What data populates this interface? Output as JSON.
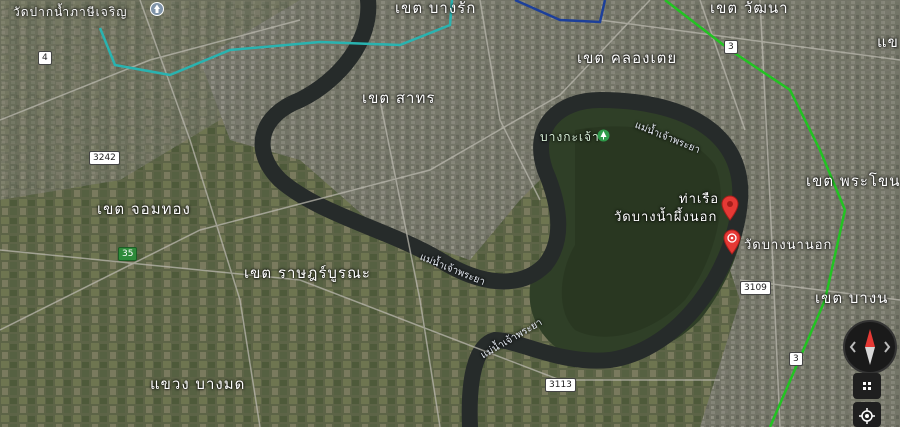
{
  "districts": {
    "bang_rak": "เขต บางรัก",
    "wattana": "เขต วัฒนา",
    "khlong_toei": "เขต คลองเตย",
    "sathon": "เขต สาทร",
    "phra_khanong": "เขต พระโขน",
    "chom_thong": "เขต จอมทอง",
    "rat_burana": "เขต ราษฎร์บูรณะ",
    "bang_na": "เขต บางน",
    "bang_mot": "แขวง บางมด",
    "edge_top_right": "แข"
  },
  "places": {
    "wat_pak_nam": "วัดปากน้ำภาษีเจริญ",
    "bang_krachao": "บางกะเจ้า",
    "pier_line1": "ท่าเรือ",
    "pier_line2": "วัดบางน้ำผึ้งนอก",
    "wat_bang_na_nok": "วัดบางนานอก"
  },
  "river_labels": {
    "r1": "แม่น้ำเจ้าพระยา",
    "r2": "แม่น้ำเจ้าพระยา",
    "r3": "แม่น้ำเจ้าพระยา"
  },
  "route_shields": {
    "s4": "4",
    "s3242": "3242",
    "s35": "35",
    "s3_top": "3",
    "s3109": "3109",
    "s3113": "3113",
    "s3_bottom": "3"
  },
  "icons": {
    "map_pin": "map-pin-icon",
    "temple": "temple-icon",
    "park": "park-icon",
    "compass": "compass-icon",
    "layers": "apps-grid-icon",
    "location": "my-location-icon"
  },
  "colors": {
    "river": "#2a2f2c",
    "pin_red": "#e53935",
    "line_green": "#22c322",
    "line_teal": "#29b3b0",
    "line_blue": "#1c3f9a"
  }
}
